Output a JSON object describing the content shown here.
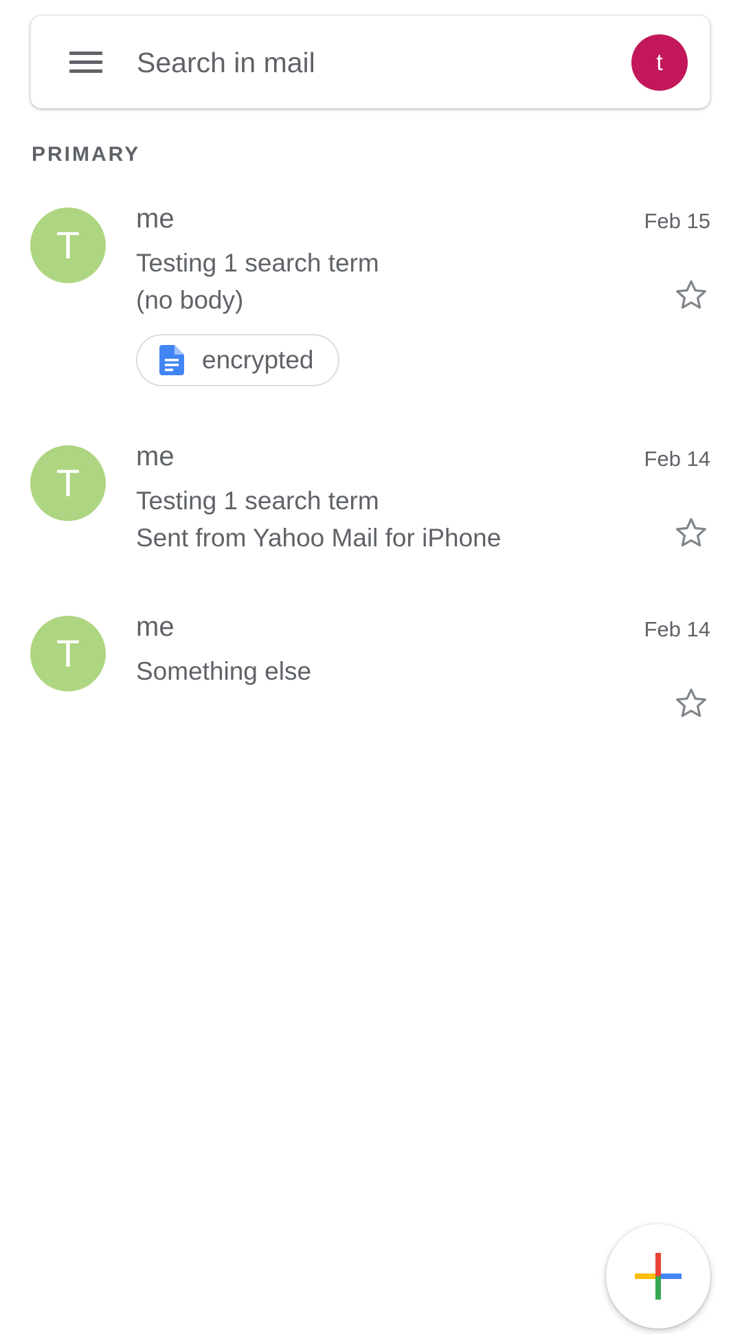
{
  "search": {
    "placeholder": "Search in mail",
    "account_initial": "t",
    "account_color": "#c2185b",
    "menu_icon": "hamburger-menu-icon"
  },
  "section": {
    "label": "PRIMARY"
  },
  "colors": {
    "avatar_bg": "#aed581",
    "text": "#5f6368",
    "doc_icon": "#4285f4"
  },
  "mails": [
    {
      "avatar": "T",
      "sender": "me",
      "date": "Feb 15",
      "subject": "Testing 1 search term",
      "snippet": "(no body)",
      "attachment": "encrypted",
      "starred": false
    },
    {
      "avatar": "T",
      "sender": "me",
      "date": "Feb 14",
      "subject": "Testing 1 search term",
      "snippet": "Sent from Yahoo Mail for iPhone",
      "starred": false
    },
    {
      "avatar": "T",
      "sender": "me",
      "date": "Feb 14",
      "subject": "Something else",
      "snippet": "",
      "starred": false
    }
  ],
  "fab": {
    "icon": "compose-plus-icon"
  }
}
